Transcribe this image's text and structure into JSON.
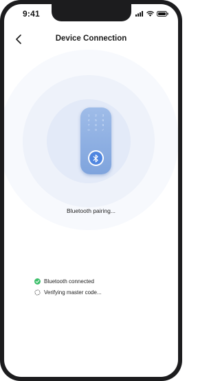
{
  "status_bar": {
    "time": "9:41",
    "signal_icon": "cellular-signal-icon",
    "wifi_icon": "wifi-icon",
    "battery_icon": "battery-icon"
  },
  "header": {
    "back_icon": "chevron-left-icon",
    "title": "Device Connection"
  },
  "device": {
    "icon": "smart-lock-icon",
    "keypad_keys": [
      "1",
      "2",
      "3",
      "4",
      "5",
      "6",
      "7",
      "8",
      "9",
      "∞",
      "0",
      "✓"
    ],
    "badge_icon": "bluetooth-icon"
  },
  "status": {
    "pairing_text": "Bluetooth pairing..."
  },
  "steps": [
    {
      "label": "Bluetooth connected",
      "state": "done",
      "icon": "check-circle-icon"
    },
    {
      "label": "Verifying master code...",
      "state": "in-progress",
      "icon": "loading-spinner-icon"
    }
  ],
  "colors": {
    "accent": "#4f86e0",
    "success": "#3cbf6a",
    "device_body": "#8fb0e3",
    "halo": "#eef2fa"
  }
}
